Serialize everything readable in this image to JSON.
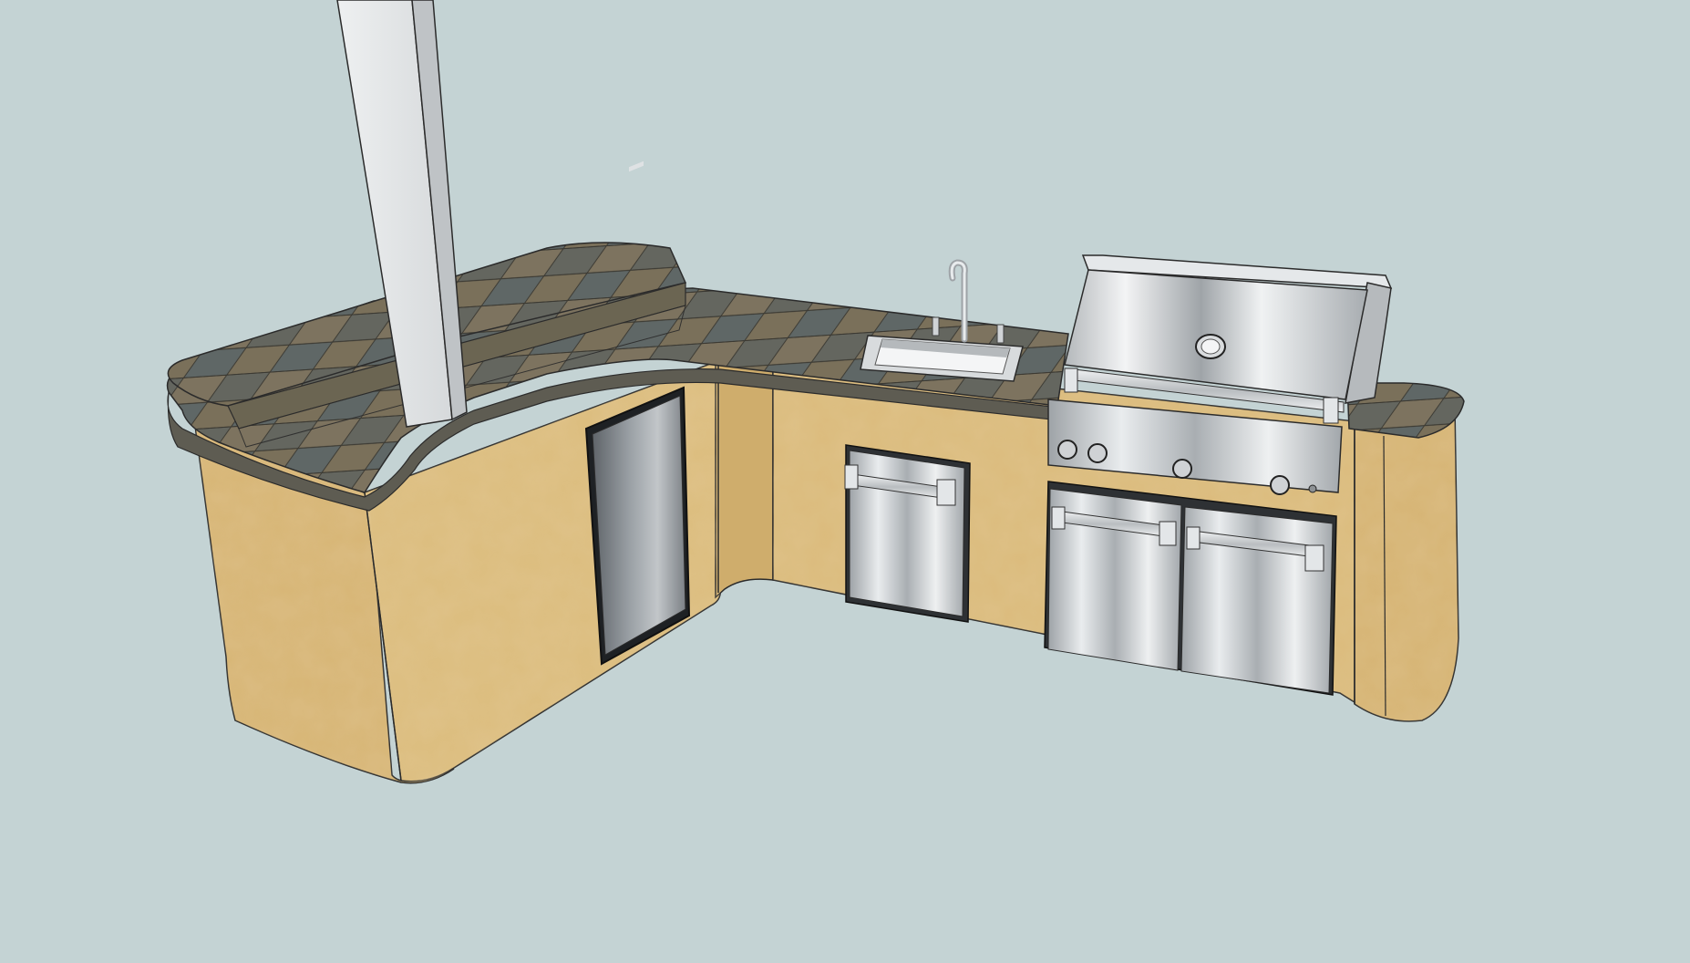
{
  "colors": {
    "background": "#c4d3d4",
    "stucco": "#d9b878",
    "stucco_shadow": "#c8a466",
    "tile": "#6d6a5c",
    "steel": "#c9ccce",
    "steel_dark": "#8d9194",
    "fridge": "#7d8287",
    "post": "#e4e6e8",
    "outline": "#2b2b2b"
  },
  "icons": {
    "grill": "grill-icon",
    "sink": "sink-icon",
    "faucet": "faucet-icon",
    "fridge": "fridge-icon",
    "post": "post-icon"
  }
}
